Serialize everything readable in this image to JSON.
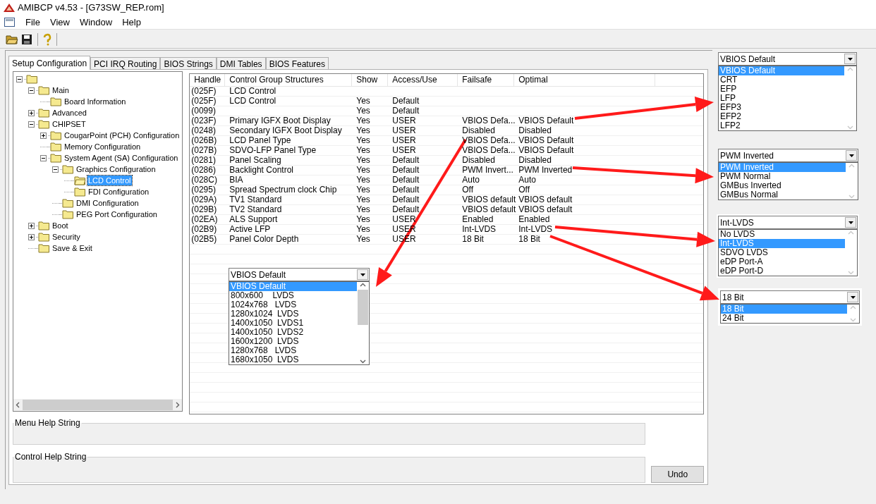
{
  "window": {
    "title": "AMIBCP v4.53 - [G73SW_REP.rom]"
  },
  "menu": [
    "File",
    "View",
    "Window",
    "Help"
  ],
  "tabs": [
    {
      "label": "Setup Configuration",
      "selected": true
    },
    {
      "label": "PCI IRQ Routing",
      "selected": false
    },
    {
      "label": "BIOS Strings",
      "selected": false
    },
    {
      "label": "DMI Tables",
      "selected": false
    },
    {
      "label": "BIOS Features",
      "selected": false
    }
  ],
  "tree": [
    {
      "expanded": true,
      "selected": false,
      "children": [
        {
          "label": "Main",
          "expanded": true,
          "selected": false,
          "children": [
            {
              "label": "Board Information",
              "selected": false
            }
          ]
        },
        {
          "label": "Advanced",
          "expanded": false,
          "selected": false
        },
        {
          "label": "CHIPSET",
          "expanded": true,
          "selected": false,
          "children": [
            {
              "label": "CougarPoint (PCH) Configuration",
              "expanded": false,
              "selected": false
            },
            {
              "label": "Memory Configuration",
              "selected": false
            },
            {
              "label": "System Agent (SA) Configuration",
              "expanded": true,
              "selected": false,
              "children": [
                {
                  "label": "Graphics Configuration",
                  "expanded": true,
                  "selected": false,
                  "children": [
                    {
                      "label": "LCD Control",
                      "selected": true
                    },
                    {
                      "label": "FDI Configuration",
                      "selected": false
                    }
                  ]
                },
                {
                  "label": "DMI Configuration",
                  "selected": false
                },
                {
                  "label": "PEG Port Configuration",
                  "selected": false
                }
              ]
            }
          ]
        },
        {
          "label": "Boot",
          "expanded": false,
          "selected": false
        },
        {
          "label": "Security",
          "expanded": false,
          "selected": false
        },
        {
          "label": "Save & Exit",
          "selected": false
        }
      ]
    }
  ],
  "table": {
    "columns": [
      "Handle",
      "Control Group Structures",
      "Show",
      "Access/Use",
      "Failsafe",
      "Optimal"
    ],
    "rows": [
      {
        "handle": "(025F)",
        "name": "LCD Control"
      },
      {
        "handle": "(025F)",
        "name": "LCD Control",
        "show": "Yes",
        "access": "Default"
      },
      {
        "handle": "(0099)",
        "show": "Yes",
        "access": "Default"
      },
      {
        "handle": "(023F)",
        "name": "Primary IGFX Boot Display",
        "show": "Yes",
        "access": "USER",
        "failsafe": "VBIOS Defa...",
        "optimal": "VBIOS Default"
      },
      {
        "handle": "(0248)",
        "name": "Secondary IGFX Boot Display",
        "show": "Yes",
        "access": "USER",
        "failsafe": "Disabled",
        "optimal": "Disabled"
      },
      {
        "handle": "(026B)",
        "name": "LCD Panel Type",
        "show": "Yes",
        "access": "USER",
        "failsafe": "VBIOS Defa...",
        "optimal": "VBIOS Default"
      },
      {
        "handle": "(027B)",
        "name": "SDVO-LFP Panel Type",
        "show": "Yes",
        "access": "USER",
        "failsafe": "VBIOS Defa...",
        "optimal": "VBIOS Default"
      },
      {
        "handle": "(0281)",
        "name": "Panel Scaling",
        "show": "Yes",
        "access": "Default",
        "failsafe": "Disabled",
        "optimal": "Disabled"
      },
      {
        "handle": "(0286)",
        "name": "Backlight Control",
        "show": "Yes",
        "access": "Default",
        "failsafe": "PWM Invert...",
        "optimal": "PWM Inverted"
      },
      {
        "handle": "(028C)",
        "name": "BIA",
        "show": "Yes",
        "access": "Default",
        "failsafe": "Auto",
        "optimal": "Auto"
      },
      {
        "handle": "(0295)",
        "name": "Spread Spectrum clock Chip",
        "show": "Yes",
        "access": "Default",
        "failsafe": "Off",
        "optimal": "Off"
      },
      {
        "handle": "(029A)",
        "name": "TV1 Standard",
        "show": "Yes",
        "access": "Default",
        "failsafe": "VBIOS default",
        "optimal": "VBIOS default"
      },
      {
        "handle": "(029B)",
        "name": "TV2 Standard",
        "show": "Yes",
        "access": "Default",
        "failsafe": "VBIOS default",
        "optimal": "VBIOS default"
      },
      {
        "handle": "(02EA)",
        "name": "ALS Support",
        "show": "Yes",
        "access": "USER",
        "failsafe": "Enabled",
        "optimal": "Enabled"
      },
      {
        "handle": "(02B9)",
        "name": "Active LFP",
        "show": "Yes",
        "access": "USER",
        "failsafe": "Int-LVDS",
        "optimal": "Int-LVDS"
      },
      {
        "handle": "(02B5)",
        "name": "Panel Color Depth",
        "show": "Yes",
        "access": "USER",
        "failsafe": "18 Bit",
        "optimal": "18 Bit"
      }
    ]
  },
  "panel_dropdown": {
    "value": "VBIOS Default",
    "options": [
      {
        "label": "VBIOS Default",
        "selected": true
      },
      {
        "label": "800x600    LVDS",
        "selected": false
      },
      {
        "label": "1024x768   LVDS",
        "selected": false
      },
      {
        "label": "1280x1024  LVDS",
        "selected": false
      },
      {
        "label": "1400x1050  LVDS1",
        "selected": false
      },
      {
        "label": "1400x1050  LVDS2",
        "selected": false
      },
      {
        "label": "1600x1200  LVDS",
        "selected": false
      },
      {
        "label": "1280x768   LVDS",
        "selected": false
      },
      {
        "label": "1680x1050  LVDS",
        "selected": false
      }
    ]
  },
  "option_dropdowns": [
    {
      "value": "VBIOS Default",
      "options": [
        {
          "label": "VBIOS Default",
          "selected": true
        },
        {
          "label": "CRT",
          "selected": false
        },
        {
          "label": "EFP",
          "selected": false
        },
        {
          "label": "LFP",
          "selected": false
        },
        {
          "label": "EFP3",
          "selected": false
        },
        {
          "label": "EFP2",
          "selected": false
        },
        {
          "label": "LFP2",
          "selected": false
        }
      ]
    },
    {
      "value": "PWM Inverted",
      "options": [
        {
          "label": "PWM Inverted",
          "selected": true
        },
        {
          "label": "PWM Normal",
          "selected": false
        },
        {
          "label": "GMBus Inverted",
          "selected": false
        },
        {
          "label": "GMBus Normal",
          "selected": false
        }
      ]
    },
    {
      "value": "Int-LVDS",
      "options": [
        {
          "label": "No LVDS",
          "selected": false
        },
        {
          "label": "Int-LVDS",
          "selected": true
        },
        {
          "label": "SDVO LVDS",
          "selected": false
        },
        {
          "label": "eDP Port-A",
          "selected": false
        },
        {
          "label": "eDP Port-D",
          "selected": false
        }
      ]
    },
    {
      "value": "18 Bit",
      "options": [
        {
          "label": "18 Bit",
          "selected": true
        },
        {
          "label": "24 Bit",
          "selected": false
        }
      ]
    }
  ],
  "help": {
    "menu_label": "Menu Help String",
    "control_label": "Control Help String"
  },
  "undo_button": "Undo"
}
